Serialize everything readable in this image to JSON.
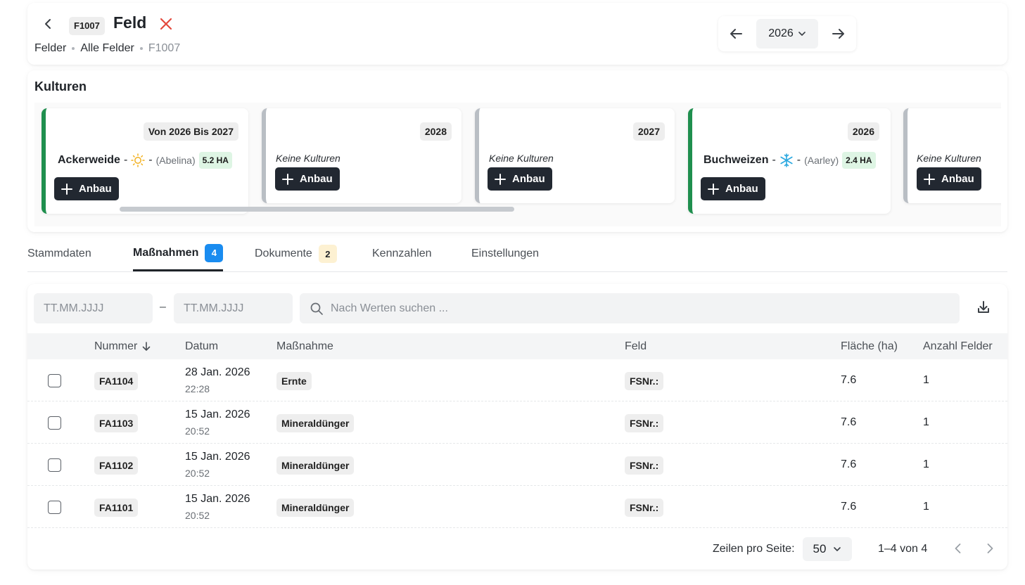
{
  "header": {
    "code": "F1007",
    "title": "Feld",
    "breadcrumb": [
      "Felder",
      "Alle Felder",
      "F1007"
    ],
    "year": "2026"
  },
  "kulturen": {
    "title": "Kulturen",
    "cards": [
      {
        "year_label": "Von 2026 Bis 2027",
        "crop": "Ackerweide",
        "variety": "(Abelina)",
        "area": "5.2 HA",
        "icon": "sun-icon",
        "button": "Anbau",
        "active": true
      },
      {
        "year_label": "2028",
        "empty_text": "Keine Kulturen",
        "button": "Anbau",
        "active": false
      },
      {
        "year_label": "2027",
        "empty_text": "Keine Kulturen",
        "button": "Anbau",
        "active": false
      },
      {
        "year_label": "2026",
        "crop": "Buchweizen",
        "variety": "(Aarley)",
        "area": "2.4 HA",
        "icon": "snowflake-icon",
        "button": "Anbau",
        "active": true
      },
      {
        "empty_text": "Keine Kulturen",
        "button": "Anbau",
        "active": false
      }
    ],
    "separator": "-"
  },
  "tabs": [
    {
      "label": "Stammdaten"
    },
    {
      "label": "Maßnahmen",
      "count": "4",
      "active": true
    },
    {
      "label": "Dokumente",
      "count": "2"
    },
    {
      "label": "Kennzahlen"
    },
    {
      "label": "Einstellungen"
    }
  ],
  "filters": {
    "date_from_placeholder": "TT.MM.JJJJ",
    "date_to_placeholder": "TT.MM.JJJJ",
    "date_separator": "–",
    "search_placeholder": "Nach Werten suchen ..."
  },
  "table": {
    "columns": [
      "Nummer",
      "Datum",
      "Maßnahme",
      "Feld",
      "Fläche (ha)",
      "Anzahl Felder"
    ],
    "rows": [
      {
        "nummer": "FA1104",
        "date": "28 Jan. 2026",
        "time": "22:28",
        "massnahme": "Ernte",
        "feld": "FSNr.:",
        "flaeche": "7.6",
        "anzahl": "1"
      },
      {
        "nummer": "FA1103",
        "date": "15 Jan. 2026",
        "time": "20:52",
        "massnahme": "Mineraldünger",
        "feld": "FSNr.:",
        "flaeche": "7.6",
        "anzahl": "1"
      },
      {
        "nummer": "FA1102",
        "date": "15 Jan. 2026",
        "time": "20:52",
        "massnahme": "Mineraldünger",
        "feld": "FSNr.:",
        "flaeche": "7.6",
        "anzahl": "1"
      },
      {
        "nummer": "FA1101",
        "date": "15 Jan. 2026",
        "time": "20:52",
        "massnahme": "Mineraldünger",
        "feld": "FSNr.:",
        "flaeche": "7.6",
        "anzahl": "1"
      }
    ]
  },
  "pagination": {
    "rows_per_page_label": "Zeilen pro Seite:",
    "rows_per_page": "50",
    "range": "1–4 von 4"
  },
  "colors": {
    "accent_blue": "#1a8cf0",
    "active_green": "#1f8f4e",
    "area_badge_bg": "#def5e4",
    "doc_count_bg": "#fdf1d2",
    "dark_button": "#222831",
    "close_red": "#e4493d"
  }
}
